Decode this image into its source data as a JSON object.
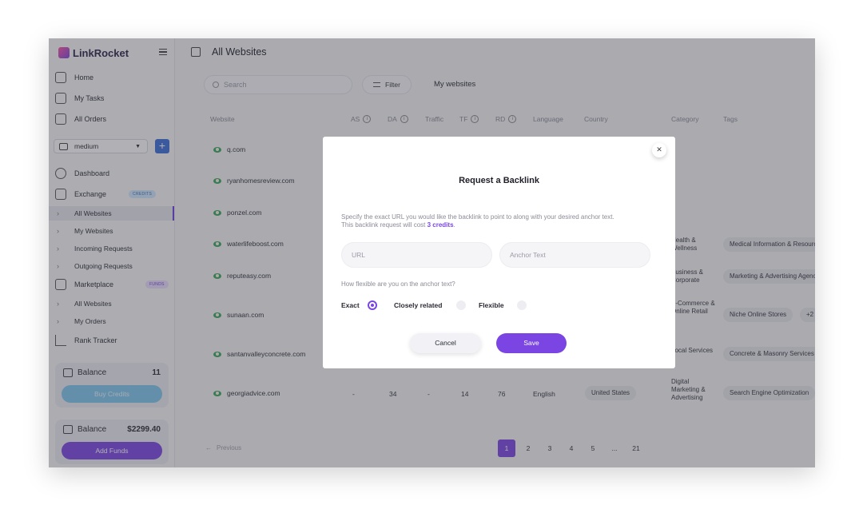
{
  "sidebar": {
    "logo": "LinkRocket",
    "nav_top": [
      {
        "label": "Home",
        "icon": "home-icon"
      },
      {
        "label": "My Tasks",
        "icon": "pencil-icon"
      },
      {
        "label": "All Orders",
        "icon": "cart-icon"
      }
    ],
    "select_value": "medium",
    "nav_main": [
      {
        "label": "Dashboard",
        "icon": "gauge-icon"
      },
      {
        "label": "Exchange",
        "icon": "exchange-icon",
        "badge": "CREDITS"
      }
    ],
    "exchange_sub": [
      "All Websites",
      "My Websites",
      "Incoming Requests",
      "Outgoing Requests"
    ],
    "marketplace": {
      "label": "Marketplace",
      "badge": "FUNDS"
    },
    "marketplace_sub": [
      "All Websites",
      "My Orders"
    ],
    "rank_tracker": "Rank Tracker",
    "credits_balance": {
      "label": "Balance",
      "amount": "11",
      "button": "Buy Credits"
    },
    "funds_balance": {
      "label": "Balance",
      "amount": "$2299.40",
      "button": "Add Funds"
    }
  },
  "header": {
    "title": "All Websites"
  },
  "toolbar": {
    "search_placeholder": "Search",
    "filter_label": "Filter",
    "my_websites": "My websites"
  },
  "table": {
    "headers": {
      "website": "Website",
      "as": "AS",
      "da": "DA",
      "traffic": "Traffic",
      "tf": "TF",
      "rd": "RD",
      "language": "Language",
      "country": "Country",
      "category": "Category",
      "tags": "Tags"
    },
    "rows": [
      {
        "site": "q.com"
      },
      {
        "site": "ryanhomesreview.com"
      },
      {
        "site": "ponzel.com"
      },
      {
        "site": "waterlifeboost.com",
        "category": "Health & Wellness",
        "tag": "Medical Information & Resources"
      },
      {
        "site": "reputeasy.com",
        "category": "Business & Corporate",
        "tag": "Marketing & Advertising Agencies"
      },
      {
        "site": "sunaan.com",
        "category": "E-Commerce & Online Retail",
        "tag": "Niche Online Stores",
        "extra": "+2"
      },
      {
        "site": "santanvalleyconcrete.com",
        "category": "Local Services",
        "tag": "Concrete & Masonry Services"
      },
      {
        "site": "georgiadvice.com",
        "as": "-",
        "da": "34",
        "traffic": "-",
        "tf": "14",
        "rd": "76",
        "language": "English",
        "country": "United States",
        "category": "Digital Marketing & Advertising",
        "tag": "Search Engine Optimization"
      }
    ]
  },
  "pagination": {
    "previous": "Previous",
    "pages": [
      "1",
      "2",
      "3",
      "4",
      "5",
      "...",
      "21"
    ],
    "current": "1"
  },
  "modal": {
    "title": "Request a Backlink",
    "description_1": "Specify the exact URL you would like the backlink to point to along with your desired anchor text.",
    "description_2": "This backlink request will cost",
    "credits": "3 credits",
    "period": ".",
    "url_placeholder": "URL",
    "anchor_placeholder": "Anchor Text",
    "question": "How flexible are you on the anchor text?",
    "options": [
      "Exact",
      "Closely related",
      "Flexible"
    ],
    "selected_option": "Exact",
    "cancel_label": "Cancel",
    "save_label": "Save",
    "accent": "#7a45e3"
  }
}
